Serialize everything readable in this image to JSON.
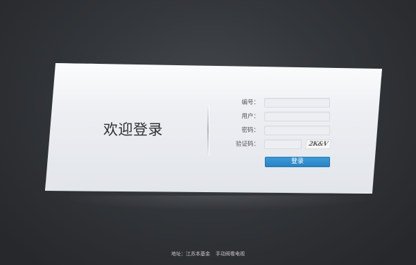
{
  "welcome_title": "欢迎登录",
  "form": {
    "fields": [
      {
        "label": "编号：",
        "value": "",
        "placeholder": ""
      },
      {
        "label": "用户：",
        "value": "",
        "placeholder": ""
      },
      {
        "label": "密码：",
        "value": "",
        "placeholder": ""
      },
      {
        "label": "验证码：",
        "value": "",
        "placeholder": ""
      }
    ],
    "captcha_text": "2K&V",
    "login_label": "登录"
  },
  "footer": {
    "address": "地址：江苏本基金",
    "company": "手动阀看电视"
  },
  "colors": {
    "background": "#2f3236",
    "card": "#eceef2",
    "button": "#2a83c4"
  }
}
